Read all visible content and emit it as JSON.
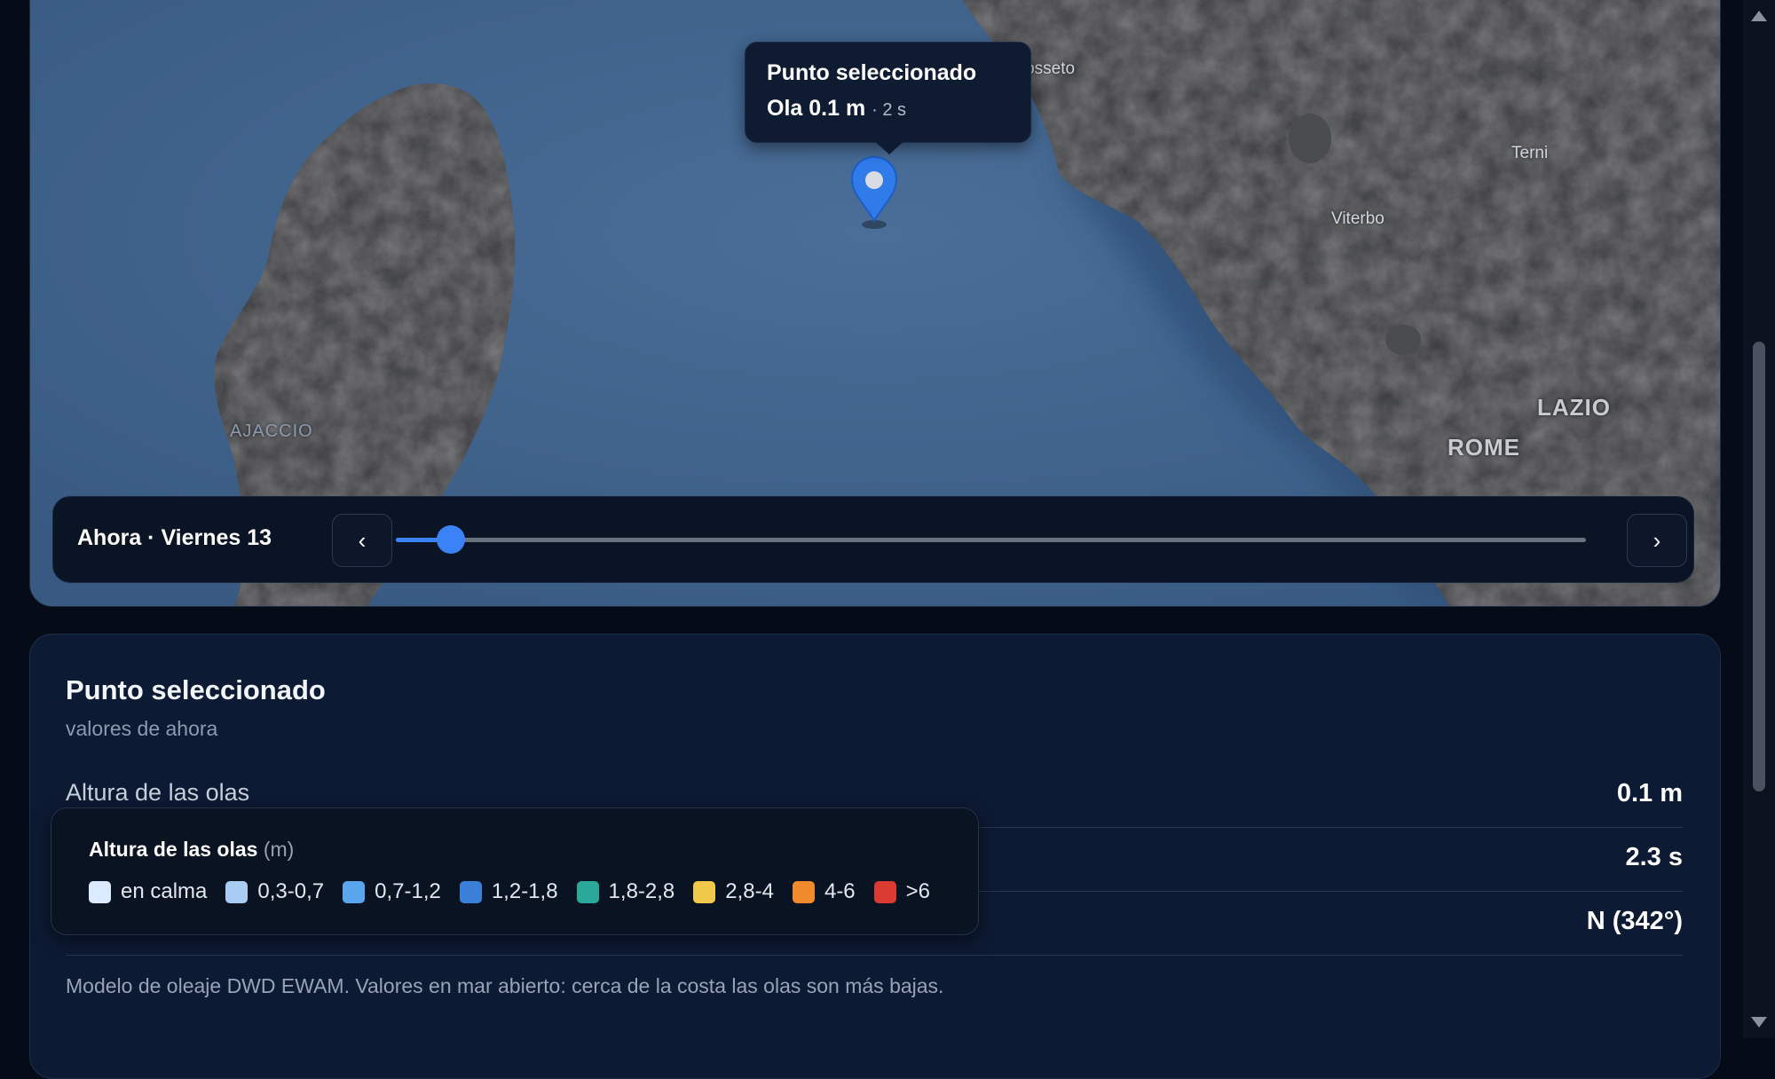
{
  "map": {
    "places": [
      "Grosseto",
      "Terni",
      "Viterbo",
      "LAZIO",
      "ROME",
      "AJACCIO"
    ],
    "popup": {
      "title": "Punto seleccionado",
      "wave": "Ola 0.1 m",
      "period": "· 2 s"
    },
    "marker_icon": "map-pin-icon",
    "accent_color": "#3b82f6"
  },
  "timeline": {
    "label": "Ahora · Viernes 13",
    "prev_label": "‹",
    "next_label": "›",
    "progress": 0.046
  },
  "panel": {
    "title": "Punto seleccionado",
    "subtitle": "valores de ahora",
    "rows": [
      {
        "label": "Altura de las olas",
        "value": "0.1 m"
      },
      {
        "label": "",
        "value": "2.3 s"
      },
      {
        "label": "",
        "value": "N (342°)"
      }
    ],
    "footnote": "Modelo de oleaje DWD EWAM. Valores en mar abierto: cerca de la costa las olas son más bajas."
  },
  "legend": {
    "title": "Altura de las olas",
    "unit": "(m)",
    "items": [
      {
        "label": "en calma",
        "color": "#dbeafe"
      },
      {
        "label": "0,3-0,7",
        "color": "#a9cdf2"
      },
      {
        "label": "0,7-1,2",
        "color": "#5aa6ee"
      },
      {
        "label": "1,2-1,8",
        "color": "#3a7fd8"
      },
      {
        "label": "1,8-2,8",
        "color": "#2aa89a"
      },
      {
        "label": "2,8-4",
        "color": "#f1c94a"
      },
      {
        "label": "4-6",
        "color": "#f08a2c"
      },
      {
        "label": ">6",
        "color": "#dc3b32"
      }
    ]
  }
}
